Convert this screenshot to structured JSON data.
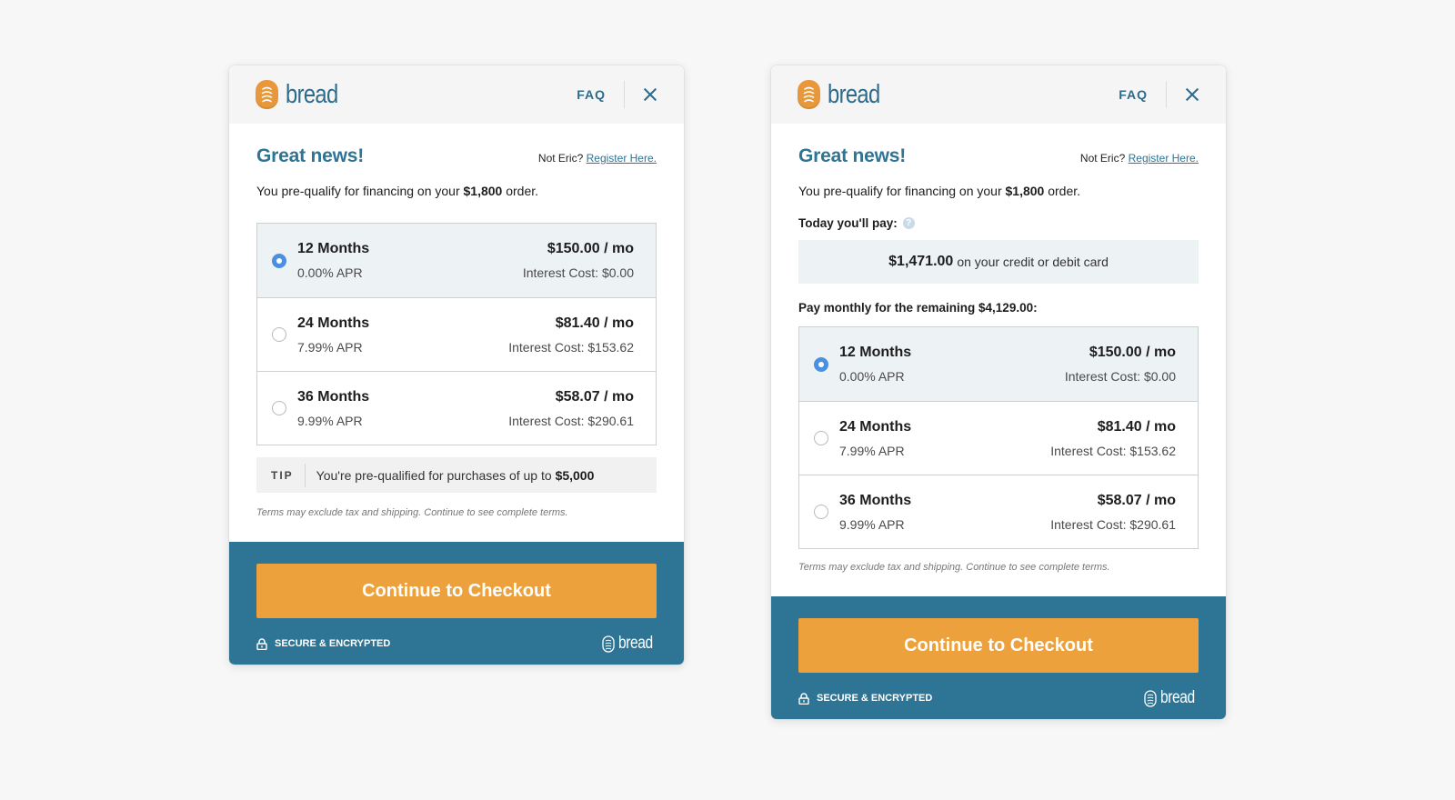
{
  "colors": {
    "brand_blue": "#2e7494",
    "cta_orange": "#eda13d",
    "logo_orange": "#e8973a",
    "radio_blue": "#4a8fe0",
    "page_bg": "#f7f7f7"
  },
  "modals": [
    {
      "header": {
        "logo_text": "bread",
        "faq_label": "FAQ",
        "close_icon": "close-icon"
      },
      "title": "Great news!",
      "not_user": "Not Eric?",
      "register_link": "Register Here.",
      "prequal_prefix": "You pre-qualify for financing on your",
      "prequal_amount": "$1,800",
      "prequal_suffix": "order.",
      "options": [
        {
          "term": "12 Months",
          "apr": "0.00% APR",
          "payment": "$150.00 / mo",
          "interest": "Interest Cost: $0.00",
          "selected": true
        },
        {
          "term": "24 Months",
          "apr": "7.99% APR",
          "payment": "$81.40 / mo",
          "interest": "Interest Cost: $153.62",
          "selected": false
        },
        {
          "term": "36 Months",
          "apr": "9.99% APR",
          "payment": "$58.07 / mo",
          "interest": "Interest Cost: $290.61",
          "selected": false
        }
      ],
      "tip": {
        "label": "TIP",
        "text": "You're pre-qualified for purchases of up to",
        "amount": "$5,000"
      },
      "terms": "Terms may exclude tax and shipping. Continue to see complete terms.",
      "footer": {
        "cta_label": "Continue to Checkout",
        "secure_label": "SECURE & ENCRYPTED",
        "footer_logo_text": "bread"
      }
    },
    {
      "header": {
        "logo_text": "bread",
        "faq_label": "FAQ",
        "close_icon": "close-icon"
      },
      "title": "Great news!",
      "not_user": "Not Eric?",
      "register_link": "Register Here.",
      "prequal_prefix": "You pre-qualify for financing on your",
      "prequal_amount": "$1,800",
      "prequal_suffix": "order.",
      "today_label": "Today you'll pay:",
      "today_amount": "$1,471.00",
      "today_suffix": "on your credit or debit card",
      "remaining_label": "Pay monthly for the remaining $4,129.00:",
      "options": [
        {
          "term": "12 Months",
          "apr": "0.00% APR",
          "payment": "$150.00 / mo",
          "interest": "Interest Cost: $0.00",
          "selected": true
        },
        {
          "term": "24 Months",
          "apr": "7.99% APR",
          "payment": "$81.40 / mo",
          "interest": "Interest Cost: $153.62",
          "selected": false
        },
        {
          "term": "36 Months",
          "apr": "9.99% APR",
          "payment": "$58.07 / mo",
          "interest": "Interest Cost: $290.61",
          "selected": false
        }
      ],
      "terms": "Terms may exclude tax and shipping. Continue to see complete terms.",
      "footer": {
        "cta_label": "Continue to Checkout",
        "secure_label": "SECURE & ENCRYPTED",
        "footer_logo_text": "bread"
      }
    }
  ]
}
